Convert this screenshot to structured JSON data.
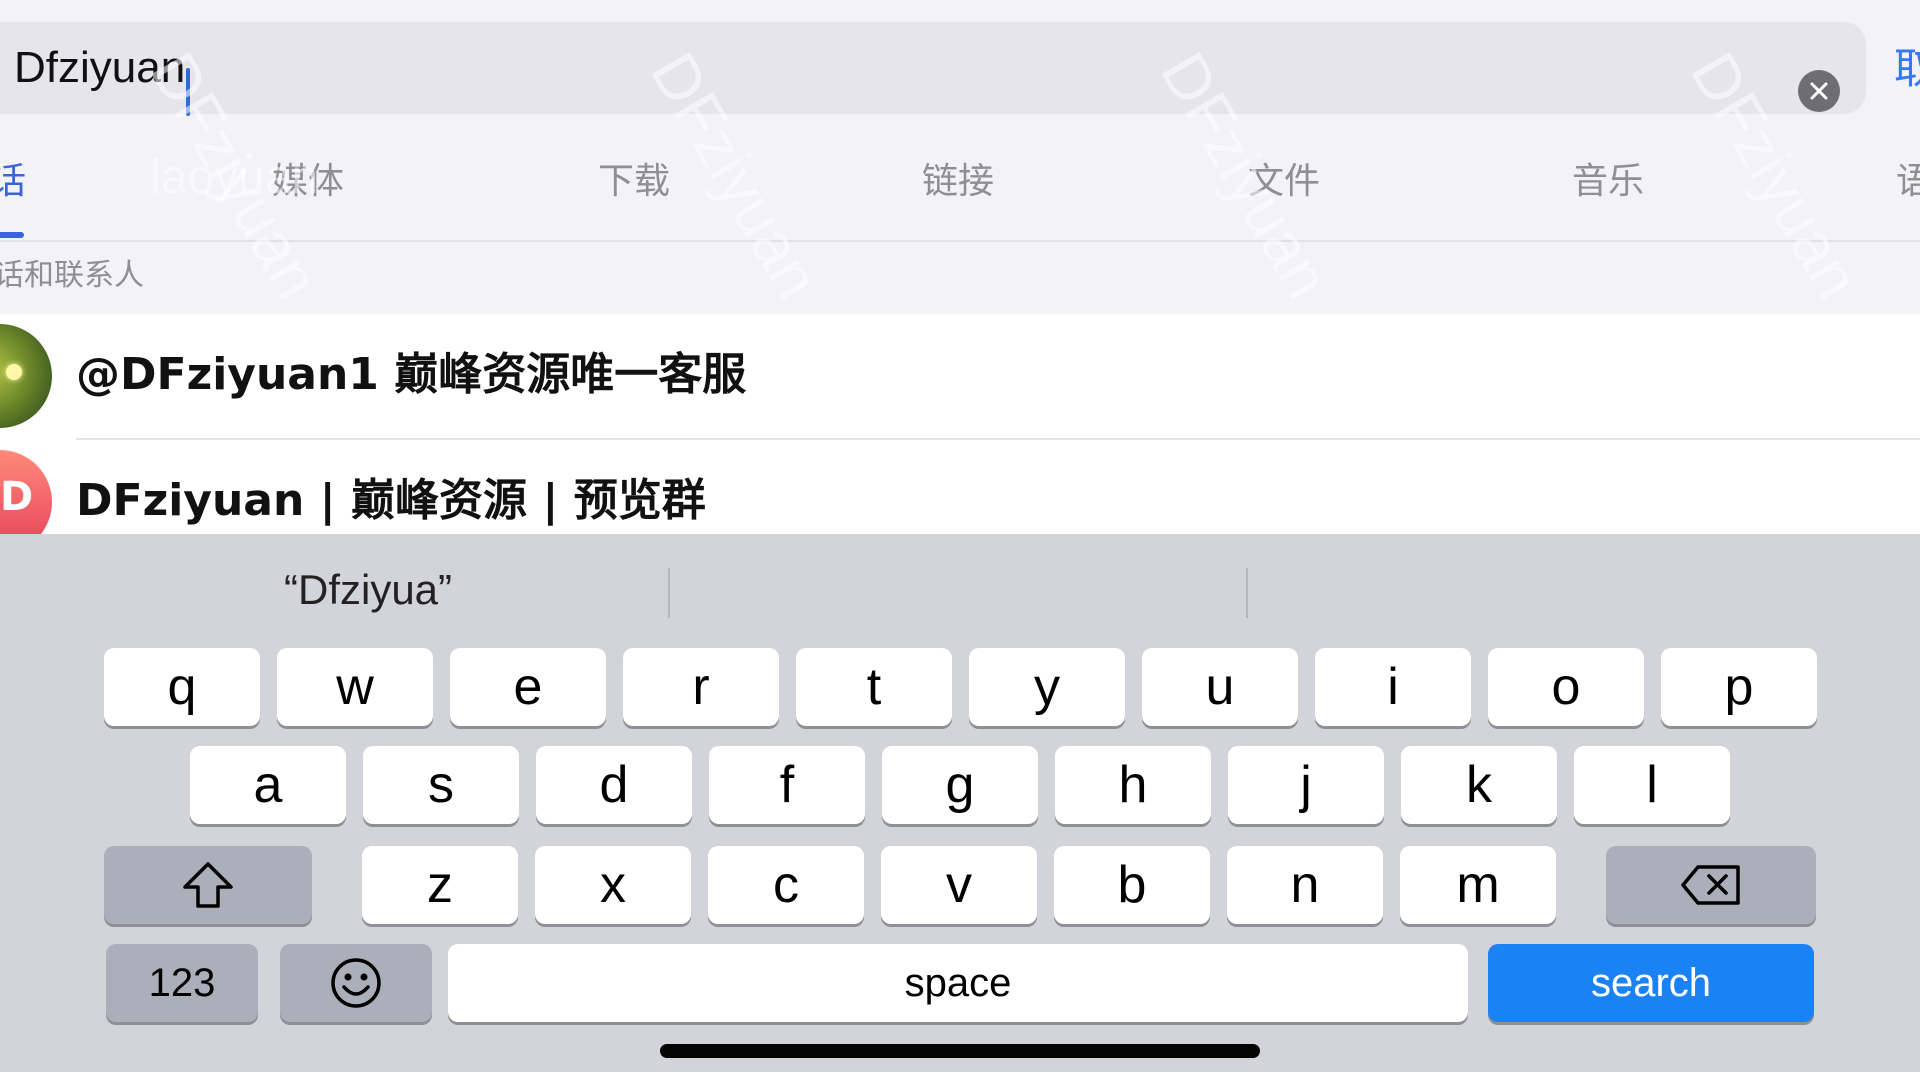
{
  "search": {
    "query": "Dfziyuan",
    "cancel_label": "取"
  },
  "tabs": [
    {
      "label": "话",
      "active": true
    },
    {
      "label": "媒体",
      "active": false
    },
    {
      "label": "下载",
      "active": false
    },
    {
      "label": "链接",
      "active": false
    },
    {
      "label": "文件",
      "active": false
    },
    {
      "label": "音乐",
      "active": false
    },
    {
      "label": "语",
      "active": false
    }
  ],
  "section": {
    "title": "话和联系人"
  },
  "results": [
    {
      "title": "@DFziyuan1 巅峰资源唯一客服",
      "avatar": "frog-avatar"
    },
    {
      "title": "DFziyuan | 巅峰资源 | 预览群",
      "avatar": "initial-avatar",
      "initial": "D"
    }
  ],
  "keyboard": {
    "suggestions": [
      "“Dfziyua”",
      "",
      ""
    ],
    "row1": [
      "q",
      "w",
      "e",
      "r",
      "t",
      "y",
      "u",
      "i",
      "o",
      "p"
    ],
    "row2": [
      "a",
      "s",
      "d",
      "f",
      "g",
      "h",
      "j",
      "k",
      "l"
    ],
    "row3": [
      "z",
      "x",
      "c",
      "v",
      "b",
      "n",
      "m"
    ],
    "numbers_label": "123",
    "space_label": "space",
    "search_label": "search"
  },
  "watermark": {
    "text": "DFziyuan",
    "text2": "laoyuan"
  },
  "colors": {
    "accent": "#3a65d8",
    "search_key": "#1a82f2",
    "keyboard_bg": "#d2d4da"
  }
}
